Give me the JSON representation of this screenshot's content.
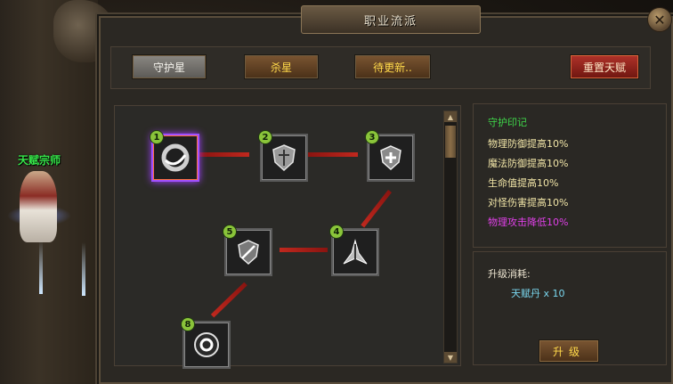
{
  "window": {
    "title": "职业流派"
  },
  "npc": {
    "name": "天赋宗师"
  },
  "tabs": [
    {
      "label": "守护星"
    },
    {
      "label": "杀星"
    },
    {
      "label": "待更新.."
    }
  ],
  "reset_label": "重置天赋",
  "talent_nodes": [
    {
      "number": "1",
      "icon": "shield-ring-icon",
      "active": true
    },
    {
      "number": "2",
      "icon": "crest-shield-icon",
      "active": false
    },
    {
      "number": "3",
      "icon": "holy-shield-icon",
      "active": false
    },
    {
      "number": "4",
      "icon": "winged-emblem-icon",
      "active": false
    },
    {
      "number": "5",
      "icon": "broken-shield-icon",
      "active": false
    },
    {
      "number": "8",
      "icon": "orb-icon",
      "active": false
    }
  ],
  "description": {
    "title": "守护印记",
    "lines": [
      {
        "text": "物理防御提高10%",
        "color": "#f2e6a8"
      },
      {
        "text": "魔法防御提高10%",
        "color": "#f2e6a8"
      },
      {
        "text": "生命值提高10%",
        "color": "#f2e6a8"
      },
      {
        "text": "对怪伤害提高10%",
        "color": "#f2e6a8"
      },
      {
        "text": "物理攻击降低10%",
        "color": "#e040e8"
      }
    ],
    "title_color": "#3fd84a"
  },
  "cost": {
    "label": "升级消耗:",
    "item": "天赋丹 x 10"
  },
  "upgrade_label": "升级"
}
